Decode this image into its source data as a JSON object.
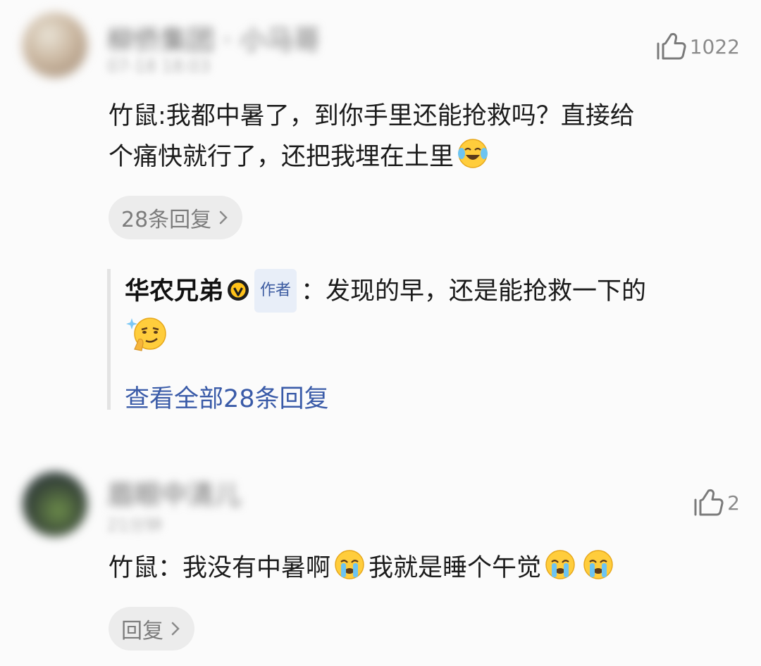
{
  "comments": [
    {
      "username": "柳侨集团 · 小马哥",
      "time": "07-18 18:03",
      "likes": "1022",
      "text_line1": "竹鼠:我都中暑了，到你手里还能抢救吗？直接给",
      "text_line2": "个痛快就行了，还把我埋在土里",
      "reply_label": "28条回复",
      "sub_reply": {
        "author": "华农兄弟",
        "tag": "作者",
        "text": "：发现的早，还是能抢救一下的",
        "view_all": "查看全部28条回复"
      }
    },
    {
      "username": "眉眼中清儿",
      "time": "21分钟",
      "likes": "2",
      "text": "竹鼠：我没有中暑啊",
      "text_tail": "我就是睡个午觉",
      "reply_label": "回复"
    }
  ],
  "colors": {
    "accent_link": "#3a5ba8",
    "tag_bg": "#e8eef8",
    "pill_bg": "#ececec"
  },
  "icons": [
    "thumbs-up-icon",
    "chevron-right-icon",
    "verified-badge-icon",
    "laugh-cry-emoji",
    "smug-emoji",
    "crying-emoji"
  ]
}
